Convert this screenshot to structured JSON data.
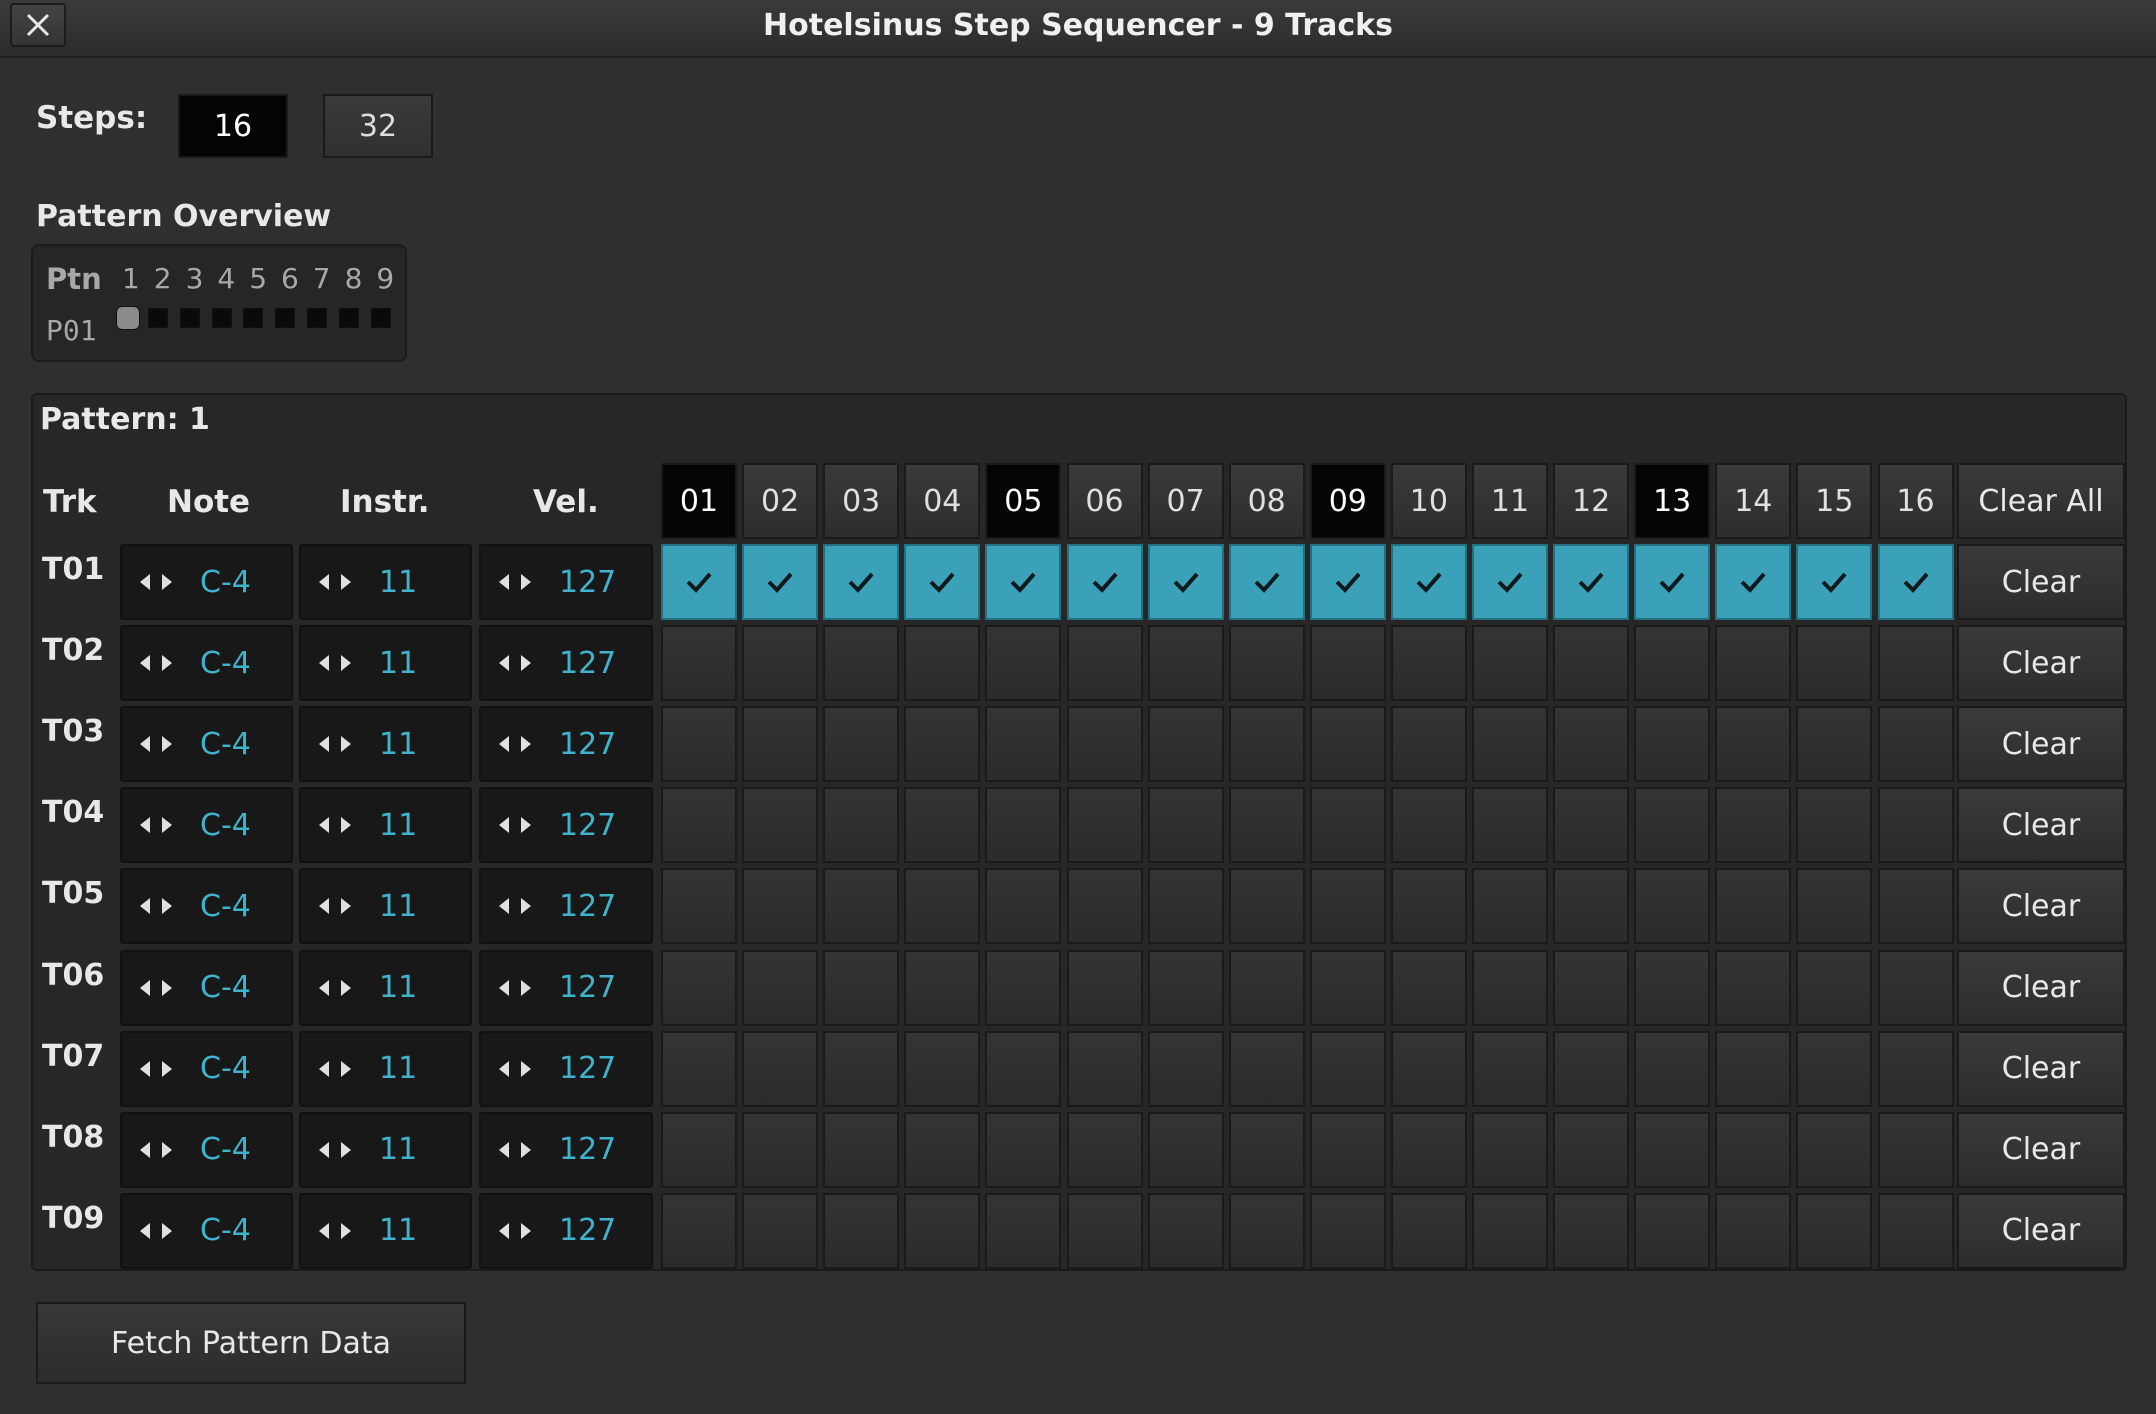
{
  "window": {
    "title": "Hotelsinus Step Sequencer - 9 Tracks",
    "close_icon": "close-icon"
  },
  "steps": {
    "label": "Steps:",
    "options": [
      "16",
      "32"
    ],
    "selected": "16"
  },
  "overview": {
    "label": "Pattern Overview",
    "header": "Ptn",
    "columns": [
      "1",
      "2",
      "3",
      "4",
      "5",
      "6",
      "7",
      "8",
      "9"
    ],
    "row_label": "P01",
    "current_column": 1
  },
  "pattern": {
    "title": "Pattern: 1",
    "headers": {
      "trk": "Trk",
      "note": "Note",
      "instr": "Instr.",
      "vel": "Vel."
    },
    "step_labels": [
      "01",
      "02",
      "03",
      "04",
      "05",
      "06",
      "07",
      "08",
      "09",
      "10",
      "11",
      "12",
      "13",
      "14",
      "15",
      "16"
    ],
    "beat_steps": [
      "01",
      "05",
      "09",
      "13"
    ],
    "clear_all_label": "Clear All",
    "clear_label": "Clear",
    "tracks": [
      {
        "name": "T01",
        "note": "C-4",
        "instr": "11",
        "vel": "127",
        "steps": [
          1,
          1,
          1,
          1,
          1,
          1,
          1,
          1,
          1,
          1,
          1,
          1,
          1,
          1,
          1,
          1
        ]
      },
      {
        "name": "T02",
        "note": "C-4",
        "instr": "11",
        "vel": "127",
        "steps": [
          0,
          0,
          0,
          0,
          0,
          0,
          0,
          0,
          0,
          0,
          0,
          0,
          0,
          0,
          0,
          0
        ]
      },
      {
        "name": "T03",
        "note": "C-4",
        "instr": "11",
        "vel": "127",
        "steps": [
          0,
          0,
          0,
          0,
          0,
          0,
          0,
          0,
          0,
          0,
          0,
          0,
          0,
          0,
          0,
          0
        ]
      },
      {
        "name": "T04",
        "note": "C-4",
        "instr": "11",
        "vel": "127",
        "steps": [
          0,
          0,
          0,
          0,
          0,
          0,
          0,
          0,
          0,
          0,
          0,
          0,
          0,
          0,
          0,
          0
        ]
      },
      {
        "name": "T05",
        "note": "C-4",
        "instr": "11",
        "vel": "127",
        "steps": [
          0,
          0,
          0,
          0,
          0,
          0,
          0,
          0,
          0,
          0,
          0,
          0,
          0,
          0,
          0,
          0
        ]
      },
      {
        "name": "T06",
        "note": "C-4",
        "instr": "11",
        "vel": "127",
        "steps": [
          0,
          0,
          0,
          0,
          0,
          0,
          0,
          0,
          0,
          0,
          0,
          0,
          0,
          0,
          0,
          0
        ]
      },
      {
        "name": "T07",
        "note": "C-4",
        "instr": "11",
        "vel": "127",
        "steps": [
          0,
          0,
          0,
          0,
          0,
          0,
          0,
          0,
          0,
          0,
          0,
          0,
          0,
          0,
          0,
          0
        ]
      },
      {
        "name": "T08",
        "note": "C-4",
        "instr": "11",
        "vel": "127",
        "steps": [
          0,
          0,
          0,
          0,
          0,
          0,
          0,
          0,
          0,
          0,
          0,
          0,
          0,
          0,
          0,
          0
        ]
      },
      {
        "name": "T09",
        "note": "C-4",
        "instr": "11",
        "vel": "127",
        "steps": [
          0,
          0,
          0,
          0,
          0,
          0,
          0,
          0,
          0,
          0,
          0,
          0,
          0,
          0,
          0,
          0
        ]
      }
    ]
  },
  "fetch_label": "Fetch Pattern Data",
  "colors": {
    "accent": "#3ba1b8",
    "value_text": "#3fb3cc",
    "background": "#2f2f2f"
  }
}
